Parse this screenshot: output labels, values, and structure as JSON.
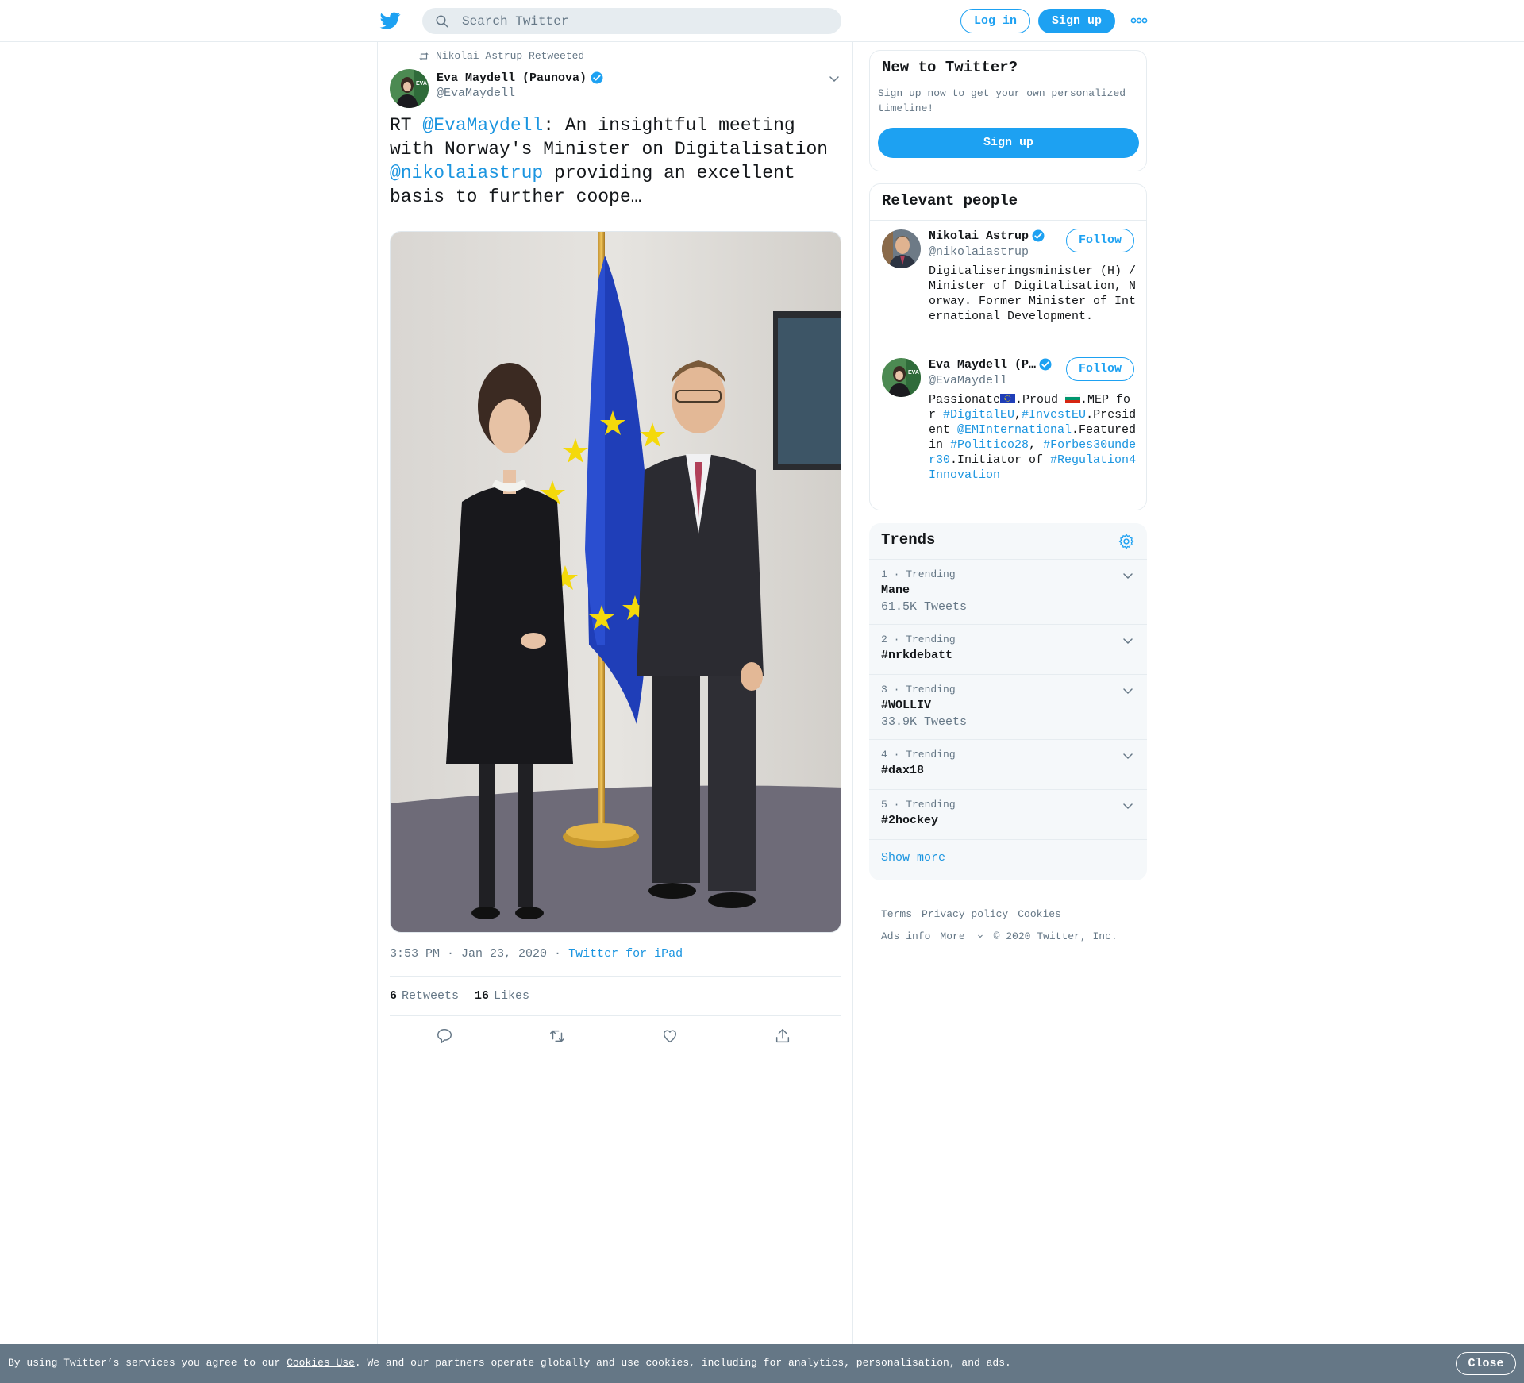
{
  "header": {
    "search_placeholder": "Search Twitter",
    "login_label": "Log in",
    "signup_label": "Sign up",
    "more_icon": "more-dots-icon"
  },
  "tweet": {
    "retweeted_by": "Nikolai Astrup Retweeted",
    "author_name": "Eva Maydell (Paunova)",
    "author_handle": "@EvaMaydell",
    "text_parts": {
      "p1": "RT ",
      "mention1": "@EvaMaydell",
      "p2": ": An insightful meeting with Norway's Minister on Digitalisation ",
      "mention2": "@nikolaiastrup",
      "p3": " providing an excellent basis to further coope…"
    },
    "timestamp": "3:53 PM · Jan 23, 2020",
    "separator": " · ",
    "source": "Twitter for iPad",
    "retweets_count": "6",
    "retweets_label": "Retweets",
    "likes_count": "16",
    "likes_label": "Likes"
  },
  "sidebar": {
    "new_to": {
      "title": "New to Twitter?",
      "text": "Sign up now to get your own personalized timeline!",
      "button": "Sign up"
    },
    "people": {
      "title": "Relevant people",
      "items": [
        {
          "name": "Nikolai Astrup",
          "handle": "@nikolaiastrup",
          "bio": "Digitaliseringsminister (H) / Minister of Digitalisation, Norway. Former Minister of International Development.",
          "follow": "Follow"
        },
        {
          "name": "Eva Maydell (P…",
          "handle": "@EvaMaydell",
          "bio_parts": {
            "a": "Passionate",
            "b": ".Proud ",
            "c": ".MEP for ",
            "tag1": "#DigitalEU",
            "d": ",",
            "tag2": "#InvestEU",
            "e": ".President ",
            "tag3": "@EMInternational",
            "f": ".Featured in ",
            "tag4": "#Politico28",
            "g": ", ",
            "tag5": "#Forbes30under30",
            "h": ".Initiator of ",
            "tag6": "#Regulation4Innovation"
          },
          "follow": "Follow"
        }
      ]
    },
    "trends": {
      "title": "Trends",
      "items": [
        {
          "meta": "1 · Trending",
          "name": "Mane",
          "count": "61.5K Tweets"
        },
        {
          "meta": "2 · Trending",
          "name": "#nrkdebatt",
          "count": ""
        },
        {
          "meta": "3 · Trending",
          "name": "#WOLLIV",
          "count": "33.9K Tweets"
        },
        {
          "meta": "4 · Trending",
          "name": "#dax18",
          "count": ""
        },
        {
          "meta": "5 · Trending",
          "name": "#2hockey",
          "count": ""
        }
      ],
      "show_more": "Show more"
    },
    "footer": {
      "terms": "Terms",
      "privacy": "Privacy policy",
      "cookies": "Cookies",
      "ads": "Ads info",
      "more": "More",
      "copyright": "© 2020 Twitter, Inc."
    }
  },
  "cookie_bar": {
    "prefix": "By using Twitter’s services you agree to our ",
    "link": "Cookies Use",
    "suffix": ". We and our partners operate globally and use cookies, including for analytics, personalisation, and ads.",
    "close": "Close"
  },
  "colors": {
    "brand": "#1da1f2",
    "link": "#1b95e0",
    "muted": "#657786",
    "border": "#e6ecf0"
  }
}
